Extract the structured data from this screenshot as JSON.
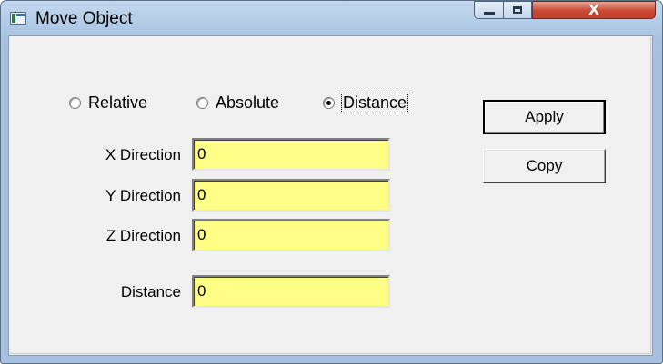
{
  "window": {
    "title": "Move Object",
    "close_symbol": "X",
    "icons": {
      "app": "app-window-icon",
      "minimize": "minimize-icon",
      "maximize": "maximize-icon",
      "close": "close-icon"
    },
    "colors": {
      "field_background": "#ffff88",
      "close_button": "#c94a33",
      "titlebar": "#b9d1ea"
    }
  },
  "mode": {
    "options": [
      {
        "label": "Relative",
        "checked": false
      },
      {
        "label": "Absolute",
        "checked": false
      },
      {
        "label": "Distance",
        "checked": true
      }
    ]
  },
  "fields": {
    "x_direction": {
      "label": "X Direction",
      "value": "0"
    },
    "y_direction": {
      "label": "Y Direction",
      "value": "0"
    },
    "z_direction": {
      "label": "Z Direction",
      "value": "0"
    },
    "distance": {
      "label": "Distance",
      "value": "0"
    }
  },
  "buttons": {
    "apply": "Apply",
    "copy": "Copy"
  }
}
